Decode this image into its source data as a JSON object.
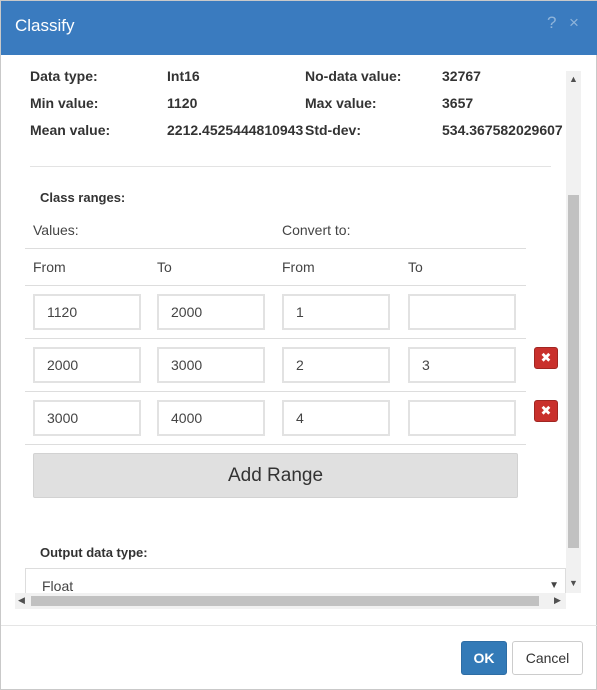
{
  "dialog": {
    "title": "Classify",
    "help_icon": "?",
    "close_icon": "×"
  },
  "info": {
    "data_type_label": "Data type:",
    "data_type_value": "Int16",
    "nodata_label": "No-data value:",
    "nodata_value": "32767",
    "min_label": "Min value:",
    "min_value": "1120",
    "max_label": "Max value:",
    "max_value": "3657",
    "mean_label": "Mean value:",
    "mean_value": "2212.4525444810943",
    "stddev_label": "Std-dev:",
    "stddev_value": "534.367582029607"
  },
  "ranges": {
    "section_label": "Class ranges:",
    "values_label": "Values:",
    "convert_label": "Convert to:",
    "col_from": "From",
    "col_to": "To",
    "col_conv_from": "From",
    "col_conv_to": "To",
    "rows": [
      {
        "from": "1120",
        "to": "2000",
        "conv_from": "1",
        "conv_to": "",
        "deletable": false
      },
      {
        "from": "2000",
        "to": "3000",
        "conv_from": "2",
        "conv_to": "3",
        "deletable": true
      },
      {
        "from": "3000",
        "to": "4000",
        "conv_from": "4",
        "conv_to": "",
        "deletable": true
      }
    ],
    "delete_icon": "✖",
    "add_range_label": "Add Range"
  },
  "output": {
    "label": "Output data type:",
    "selected": "Float",
    "caret": "▼"
  },
  "scroll": {
    "up": "▲",
    "down": "▼",
    "left": "◀",
    "right": "▶"
  },
  "footer": {
    "ok_label": "OK",
    "cancel_label": "Cancel"
  },
  "colors": {
    "titlebar": "#3a7bbf",
    "primary": "#337ab7",
    "danger": "#c9302c"
  }
}
